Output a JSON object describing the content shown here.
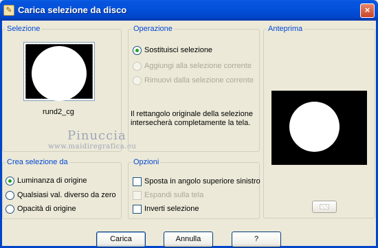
{
  "window": {
    "title": "Carica selezione da disco",
    "close_glyph": "×",
    "icon": "app-icon"
  },
  "selezione": {
    "label": "Selezione",
    "file_name": "rund2_cg"
  },
  "operazione": {
    "label": "Operazione",
    "options": [
      {
        "label": "Sostituisci selezione",
        "checked": true,
        "enabled": true
      },
      {
        "label": "Aggiungi alla selezione corrente",
        "checked": false,
        "enabled": false
      },
      {
        "label": "Rimuovi dalla selezione corrente",
        "checked": false,
        "enabled": false
      }
    ],
    "info": "Il rettangolo originale della selezione intersecherà completamente la tela."
  },
  "anteprima": {
    "label": "Anteprima"
  },
  "crea_selezione": {
    "label": "Crea selezione da",
    "options": [
      {
        "label": "Luminanza di origine",
        "checked": true
      },
      {
        "label": "Qualsiasi val. diverso da zero",
        "checked": false
      },
      {
        "label": "Opacità di origine",
        "checked": false
      }
    ]
  },
  "opzioni": {
    "label": "Opzioni",
    "options": [
      {
        "label": "Sposta in angolo superiore sinistro",
        "checked": false,
        "enabled": true
      },
      {
        "label": "Espandi sulla tela",
        "checked": false,
        "enabled": false
      },
      {
        "label": "Inverti selezione",
        "checked": false,
        "enabled": true
      }
    ]
  },
  "buttons": {
    "load": "Carica",
    "cancel": "Annulla",
    "help": "?"
  },
  "watermark": {
    "name": "Pinuccia",
    "site": "www.maidiregrafica.eu"
  }
}
